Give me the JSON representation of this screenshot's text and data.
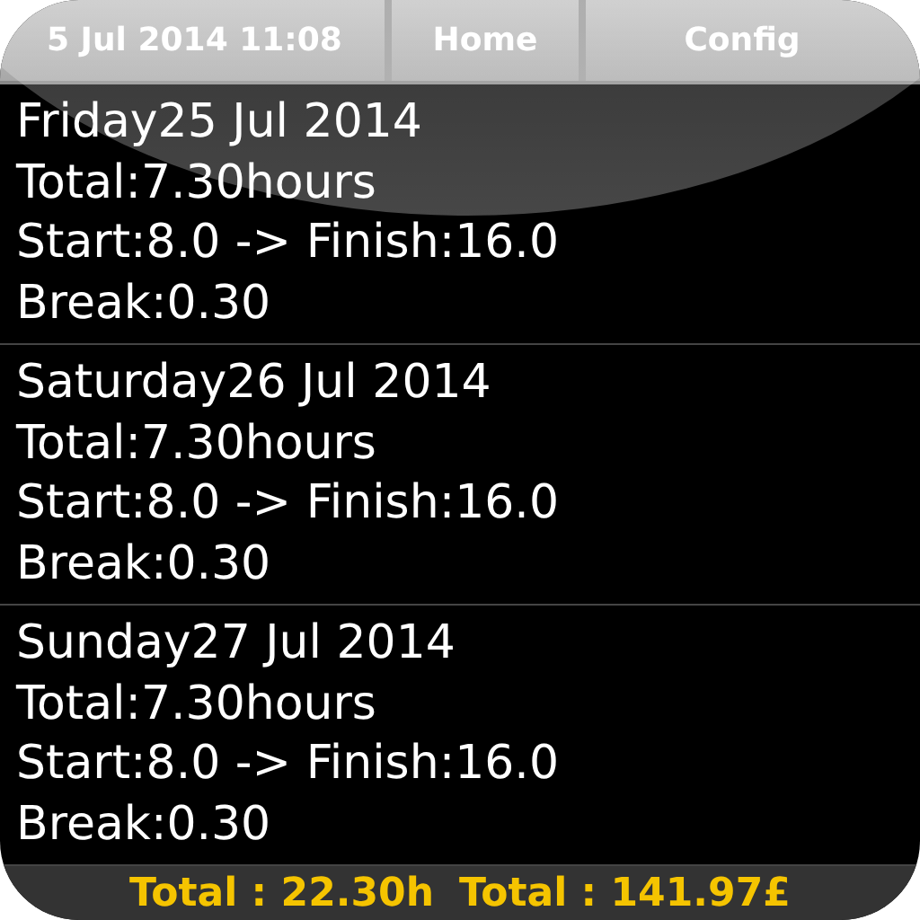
{
  "top_bar": {
    "date_time": "5 Jul 2014 11:08",
    "buttons": [
      {
        "label": "Home"
      },
      {
        "label": "Config"
      }
    ]
  },
  "entries": [
    {
      "day": "Friday25 Jul 2014",
      "total": "Total:7.30hours",
      "times": "Start:8.0 -> Finish:16.0",
      "break": "Break:0.30"
    },
    {
      "day": "Saturday26 Jul 2014",
      "total": "Total:7.30hours",
      "times": "Start:8.0 -> Finish:16.0",
      "break": "Break:0.30"
    },
    {
      "day": "Sunday27 Jul 2014",
      "total": "Total:7.30hours",
      "times": "Start:8.0 -> Finish:16.0",
      "break": "Break:0.30"
    }
  ],
  "footer": {
    "total_hours": "Total : 22.30h",
    "total_money": "Total : 141.97£"
  }
}
